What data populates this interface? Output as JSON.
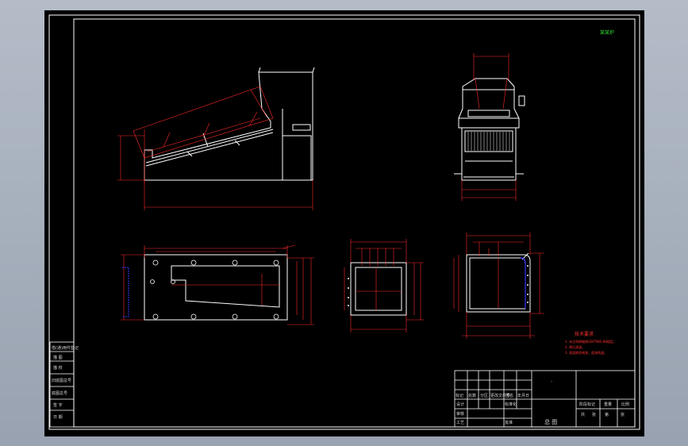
{
  "corner_label": "某某炉",
  "title_block": {
    "left_cells": [
      "借(通)用件登记",
      "描 图",
      "描 校",
      "旧底图总号",
      "底图总号",
      "签 字",
      "日 期"
    ],
    "drawing_name": "总 图",
    "approval_row": [
      "标记",
      "处数",
      "分区",
      "更改文件号",
      "签名",
      "年月日"
    ],
    "role_labels": [
      "设计",
      "标准化",
      "审核",
      "工艺",
      "批准"
    ],
    "stage_labels": [
      "阶段标记",
      "重量",
      "比例"
    ],
    "sheet_labels": [
      "共",
      "张",
      "第",
      "张"
    ]
  },
  "tech_notes": {
    "heading": "技术要求",
    "items": [
      "1. 未注明焊缝按GB/T985-88规定。",
      "2. 焊后清渣。",
      "3. 表面刷防锈漆，面漆两道。"
    ]
  },
  "colors": {
    "canvas": "#000000",
    "outline": "#ffffff",
    "dimension": "#ff2a2a",
    "hidden": "#3a3aff",
    "note": "#ff3030",
    "label": "#2ee02e"
  }
}
